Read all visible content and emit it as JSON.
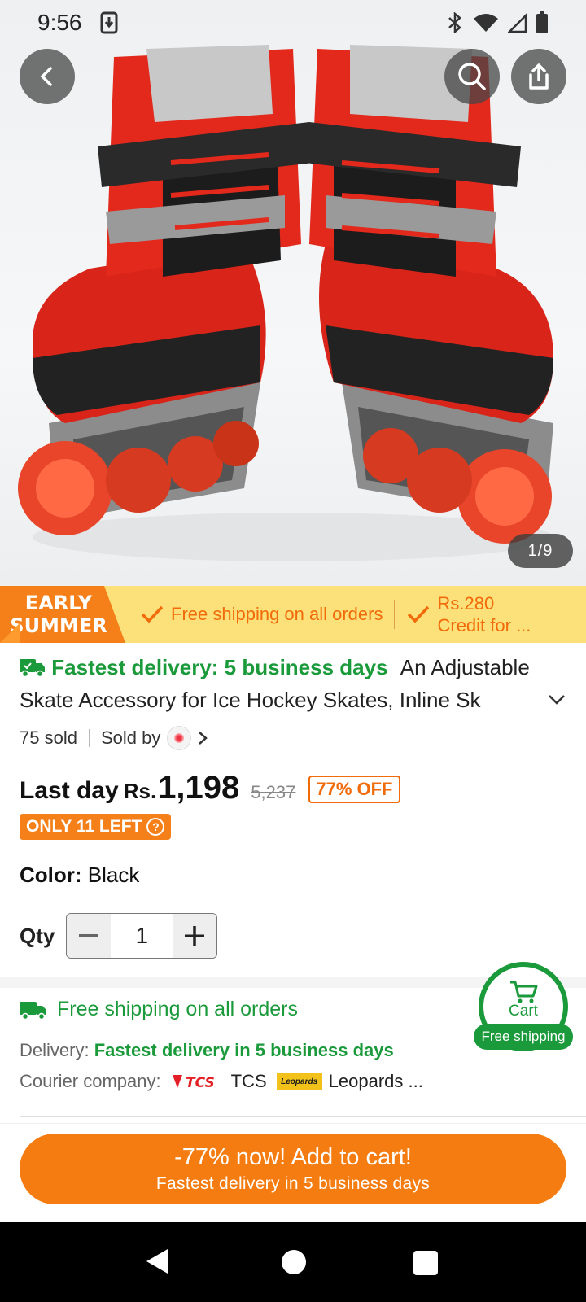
{
  "status_bar": {
    "time": "9:56"
  },
  "gallery": {
    "counter": "1/9"
  },
  "promo": {
    "badge_line1": "EARLY",
    "badge_line2": "SUMMER",
    "item1": "Free shipping on all orders",
    "item2_line1": "Rs.280",
    "item2_line2": "Credit for ..."
  },
  "product": {
    "delivery_highlight": "Fastest delivery: 5 business days",
    "title_part1": "An Adjustable",
    "title_part2": "Skate Accessory for Ice Hockey Skates, Inline Sk",
    "sold": "75 sold",
    "sold_by": "Sold by",
    "last_day": "Last day",
    "currency": "Rs.",
    "price": "1,198",
    "old_price": "5,237",
    "discount": "77% OFF",
    "stock": "ONLY 11 LEFT",
    "color_label": "Color:",
    "color_value": "Black",
    "qty_label": "Qty",
    "qty_value": "1"
  },
  "shipping": {
    "title": "Free shipping on all orders",
    "delivery_label": "Delivery:",
    "delivery_value": "Fastest delivery in 5 business days",
    "courier_label": "Courier company:",
    "courier1": "TCS",
    "courier2": "Leopards ...",
    "leopards_logo_text": "Leopards"
  },
  "cart_float": {
    "label": "Cart",
    "pill": "Free shipping"
  },
  "cta": {
    "main": "-77% now! Add to cart!",
    "sub": "Fastest delivery in 5 business days"
  },
  "colors": {
    "accent": "#f57c10",
    "green": "#1a9a3a",
    "promo_bg": "#fce17a"
  }
}
